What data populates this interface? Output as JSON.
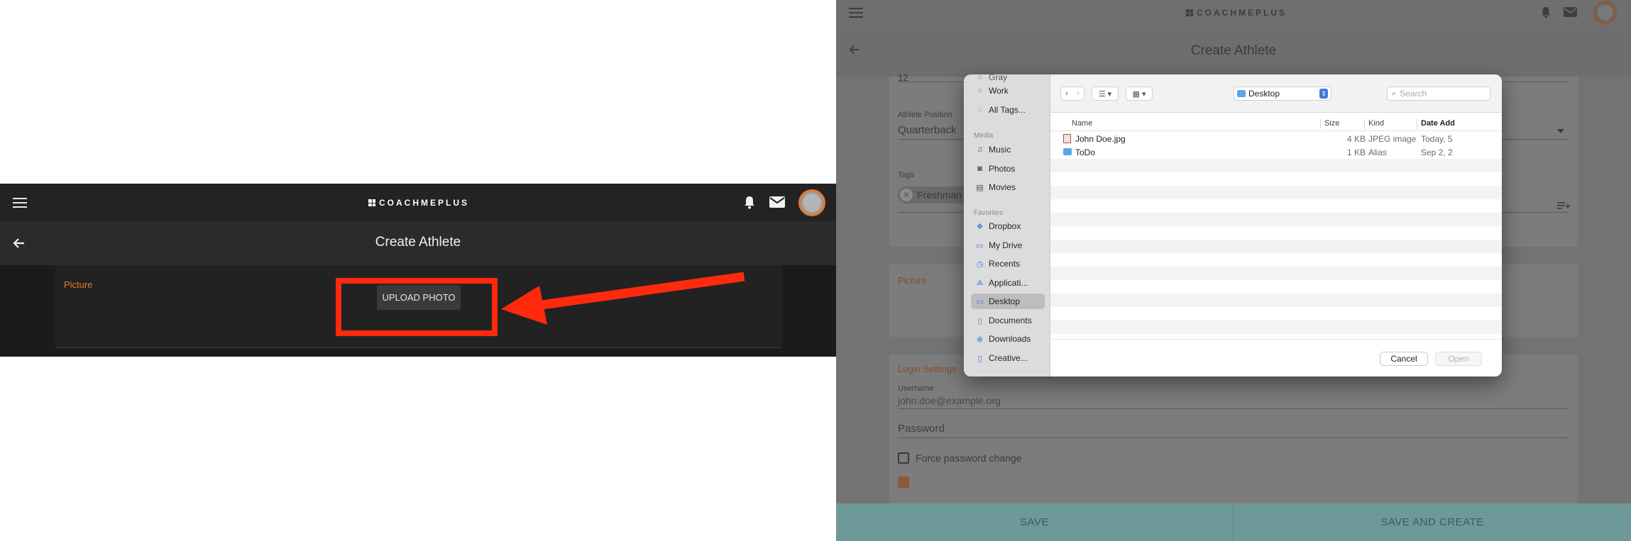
{
  "app": {
    "logo_text": "COACHMEPLUS",
    "page_title": "Create Athlete",
    "colors": {
      "accent_orange": "#e8772a",
      "annotation_red": "#ff2a0e",
      "footer_teal": "#6d9a99"
    }
  },
  "left": {
    "picture_label": "Picture",
    "upload_button": "UPLOAD PHOTO"
  },
  "right": {
    "partial_value_top": "12",
    "athlete_position": {
      "label": "Athlete Position",
      "value": "Quarterback"
    },
    "tags": {
      "label": "Tags",
      "chip": "Freshman"
    },
    "picture_label": "Picture",
    "login_settings": {
      "title": "Login Settings",
      "username_label": "Username",
      "username_placeholder": "john.doe@example.org",
      "password_placeholder": "Password",
      "force_password_change": "Force password change"
    },
    "footer": {
      "save": "SAVE",
      "save_and_create": "SAVE AND CREATE"
    }
  },
  "dialog": {
    "location": "Desktop",
    "search_placeholder": "Search",
    "sidebar": {
      "tags": [
        {
          "label": "Work"
        },
        {
          "label": "All Tags..."
        }
      ],
      "media_header": "Media",
      "media": [
        {
          "label": "Music",
          "icon": "music-note-icon"
        },
        {
          "label": "Photos",
          "icon": "camera-icon"
        },
        {
          "label": "Movies",
          "icon": "film-icon"
        }
      ],
      "favorites_header": "Favorites",
      "favorites": [
        {
          "label": "Dropbox",
          "icon": "dropbox-icon"
        },
        {
          "label": "My Drive",
          "icon": "folder-icon"
        },
        {
          "label": "Recents",
          "icon": "clock-icon"
        },
        {
          "label": "Applicati...",
          "icon": "applications-icon"
        },
        {
          "label": "Desktop",
          "icon": "desktop-icon"
        },
        {
          "label": "Documents",
          "icon": "document-icon"
        },
        {
          "label": "Downloads",
          "icon": "download-icon"
        },
        {
          "label": "Creative...",
          "icon": "document-icon"
        }
      ]
    },
    "columns": {
      "name": "Name",
      "size": "Size",
      "kind": "Kind",
      "date_added": "Date Add"
    },
    "files": [
      {
        "name": "John Doe.jpg",
        "size": "4 KB",
        "kind": "JPEG image",
        "date": "Today, 5"
      },
      {
        "name": "ToDo",
        "size": "1 KB",
        "kind": "Alias",
        "date": "Sep 2, 2"
      }
    ],
    "cancel": "Cancel",
    "open": "Open"
  }
}
